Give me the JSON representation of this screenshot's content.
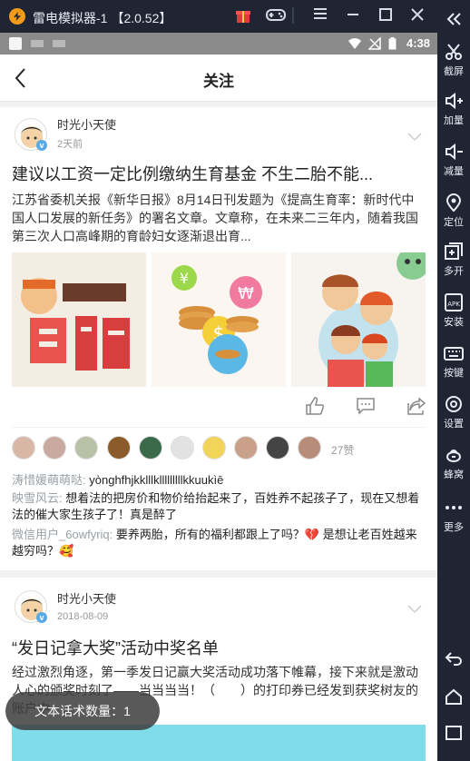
{
  "emulator": {
    "name": "雷电模拟器-1",
    "version": "【2.0.52】",
    "sidebar": [
      {
        "icon": "scissors-icon",
        "label": "截屏"
      },
      {
        "icon": "volume-up-icon",
        "label": "加量"
      },
      {
        "icon": "volume-down-icon",
        "label": "减量"
      },
      {
        "icon": "location-pin-icon",
        "label": "定位"
      },
      {
        "icon": "multi-open-icon",
        "label": "多开"
      },
      {
        "icon": "apk-install-icon",
        "label": "安装"
      },
      {
        "icon": "keyboard-icon",
        "label": "按键"
      },
      {
        "icon": "settings-gear-icon",
        "label": "设置"
      },
      {
        "icon": "bee-icon",
        "label": "蜂窝"
      },
      {
        "icon": "more-dots-icon",
        "label": "更多"
      }
    ]
  },
  "statusbar": {
    "time": "4:38"
  },
  "appbar": {
    "title": "关注"
  },
  "posts": [
    {
      "author": "时光小天使",
      "time": "2天前",
      "title": "建议以工资一定比例缴纳生育基金 不生二胎不能...",
      "summary": "江苏省委机关报《新华日报》8月14日刊发题为《提高生育率：新时代中国人口发展的新任务》的署名文章。文章称，在未来二三年内，随着我国第三次人口高峰期的育龄妇女逐渐退出育...",
      "images": [
        {
          "alt": "二胎 cartoon"
        },
        {
          "alt": "money coins"
        },
        {
          "alt": "family cartoon"
        }
      ],
      "likes": "27赞",
      "comments": [
        {
          "user": "涛惜媛萌萌哒:",
          "text": "yònghfhjkklllklllllllllkkuukìē"
        },
        {
          "user": "映雪风云:",
          "text": "想着法的把房价和物价给抬起来了，百姓养不起孩子了，现在又想着法的催大家生孩子了！真是醉了"
        },
        {
          "user": "微信用户_6owfyriq:",
          "text": "要养两胎，所有的福利都跟上了吗？💔 是想让老百姓越来越穷吗？🥰"
        }
      ]
    },
    {
      "author": "时光小天使",
      "time": "2018-08-09",
      "title": "“发日记拿大奖”活动中奖名单",
      "summary": "经过激烈角逐，第一季发日记赢大奖活动成功落下帷幕，接下来就是激动人心的颁奖时刻了——当当当当！（　　）的打印券已经发到获奖树友的账户中，..."
    }
  ],
  "toast": {
    "text": "文本话术数量：1"
  },
  "colors": {
    "accent": "#f29a1a",
    "emulator_bg": "#1f2533"
  }
}
